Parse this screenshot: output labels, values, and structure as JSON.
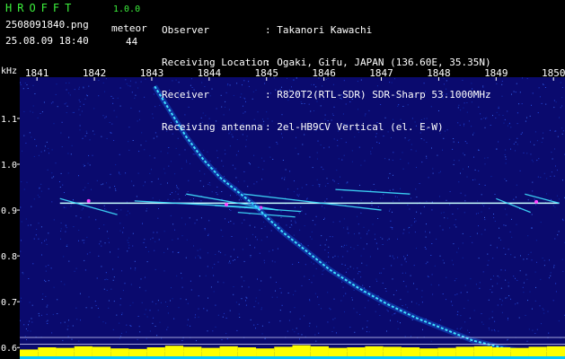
{
  "app": {
    "name": "HROFFT",
    "version": "1.0.0"
  },
  "file": {
    "name": "2508091840.png",
    "timestamp": "25.08.09 18:40"
  },
  "meteor": {
    "label": "meteor",
    "count": "44"
  },
  "station": [
    {
      "key": "Observer",
      "value": ": Takanori Kawachi"
    },
    {
      "key": "Receiving Location",
      "value": ": Ogaki, Gifu, JAPAN (136.60E, 35.35N)"
    },
    {
      "key": "Receiver",
      "value": ": R820T2(RTL-SDR) SDR-Sharp 53.1000MHz"
    },
    {
      "key": "Receiving antenna",
      "value": ": 2el-HB9CV Vertical (el. E-W)"
    }
  ],
  "colors": {
    "background": "#0a0a6e",
    "trace": "#40e0ff",
    "carrier": "#c8ffff",
    "hot": "#ff40ff",
    "power": "#ffff00",
    "base": "#00c8ff",
    "header": "#3cf03c"
  },
  "chart_data": {
    "type": "heatmap",
    "ylabel": "kHz",
    "xlim": [
      1840.7,
      1850.2
    ],
    "ylim": [
      0.575,
      1.19
    ],
    "x_ticks": [
      "1841",
      "1842",
      "1843",
      "1844",
      "1845",
      "1846",
      "1847",
      "1848",
      "1849",
      "1850"
    ],
    "y_ticks": [
      "1.1",
      "1.0",
      "0.9",
      "0.8",
      "0.7",
      "0.6"
    ],
    "y_tick_values": [
      1.1,
      1.0,
      0.9,
      0.8,
      0.7,
      0.6
    ],
    "carrier_khz": 0.915,
    "head_echo": [
      [
        1843.05,
        1.17
      ],
      [
        1843.3,
        1.12
      ],
      [
        1843.6,
        1.06
      ],
      [
        1843.9,
        1.01
      ],
      [
        1844.2,
        0.97
      ],
      [
        1844.5,
        0.94
      ],
      [
        1844.8,
        0.91
      ],
      [
        1845.0,
        0.885
      ],
      [
        1845.3,
        0.85
      ],
      [
        1845.7,
        0.81
      ],
      [
        1846.1,
        0.77
      ],
      [
        1846.6,
        0.73
      ],
      [
        1847.1,
        0.695
      ],
      [
        1847.6,
        0.665
      ],
      [
        1848.1,
        0.64
      ],
      [
        1848.6,
        0.615
      ],
      [
        1849.1,
        0.6
      ],
      [
        1849.6,
        0.588
      ]
    ],
    "echoes": [
      {
        "x": [
          1841.4,
          1842.4
        ],
        "y": [
          0.925,
          0.89
        ]
      },
      {
        "x": [
          1842.7,
          1844.9
        ],
        "y": [
          0.92,
          0.905
        ]
      },
      {
        "x": [
          1843.6,
          1845.2
        ],
        "y": [
          0.935,
          0.9
        ]
      },
      {
        "x": [
          1844.1,
          1845.6
        ],
        "y": [
          0.91,
          0.897
        ]
      },
      {
        "x": [
          1844.6,
          1847.0
        ],
        "y": [
          0.935,
          0.9
        ]
      },
      {
        "x": [
          1844.5,
          1845.5
        ],
        "y": [
          0.895,
          0.885
        ]
      },
      {
        "x": [
          1846.2,
          1847.5
        ],
        "y": [
          0.945,
          0.935
        ]
      },
      {
        "x": [
          1849.0,
          1849.6
        ],
        "y": [
          0.925,
          0.895
        ]
      },
      {
        "x": [
          1849.5,
          1850.1
        ],
        "y": [
          0.935,
          0.915
        ]
      }
    ],
    "reference_lines_khz": [
      0.622,
      0.607,
      0.592
    ],
    "power_level": [
      0.3,
      0.5,
      0.45,
      0.6,
      0.55,
      0.4,
      0.35,
      0.5,
      0.65,
      0.55,
      0.45,
      0.6,
      0.5,
      0.4,
      0.55,
      0.7,
      0.6,
      0.45,
      0.5,
      0.6,
      0.55,
      0.5,
      0.4,
      0.45,
      0.55,
      0.6,
      0.5,
      0.45,
      0.55,
      0.6
    ]
  }
}
